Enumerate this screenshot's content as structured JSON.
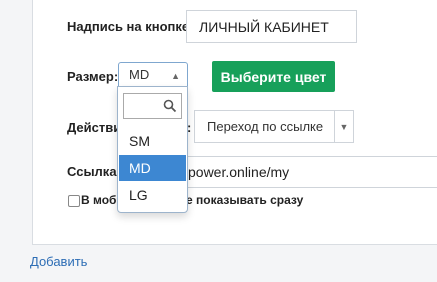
{
  "form": {
    "button_text_label": "Надпись на кнопке:",
    "button_text_value": "ЛИЧНЫЙ КАБИНЕТ",
    "size_label": "Размер:",
    "size_selected": "MD",
    "color_button": "Выберите цвет",
    "action_label_visible": "Действи",
    "action_label_tail": ":",
    "action_value": "Переход по ссылке",
    "link_label": "Ссылка:",
    "link_value": "power.online/my",
    "mobile_label_start": "В моб",
    "mobile_label_end": "е показывать сразу",
    "add_link": "Добавить"
  },
  "dropdown": {
    "options": [
      "SM",
      "MD",
      "LG"
    ],
    "selected_index": 1
  },
  "colors": {
    "accent_green": "#17a05a",
    "selected_blue": "#3d87d2",
    "link_blue": "#2d6db5"
  }
}
